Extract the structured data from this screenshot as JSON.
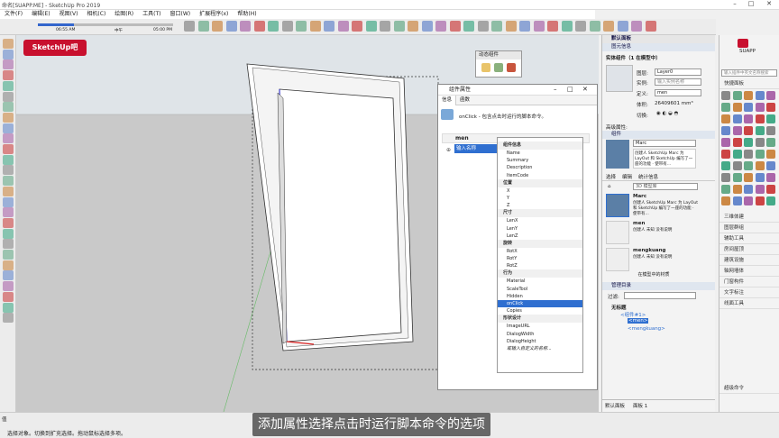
{
  "window": {
    "title": "命名[SUAPP.ME] - SketchUp Pro 2019"
  },
  "menus": [
    "文件(F)",
    "编辑(E)",
    "视图(V)",
    "相机(C)",
    "绘图(R)",
    "工具(T)",
    "窗口(W)",
    "扩展程序(x)",
    "帮助(H)"
  ],
  "shadow": {
    "time1": "06:55 AM",
    "time2": "中午",
    "time3": "05:00 PM"
  },
  "logo": {
    "text": "SketchUp吧"
  },
  "dynamic": {
    "title": "动态组件"
  },
  "attributes": {
    "title": "组件属性",
    "tab_info": "信息",
    "tab_functions": "函数",
    "onclick_desc": "onClick - 包含点击时运行的脚本命令。",
    "component_name": "men",
    "input_placeholder": "输入名称"
  },
  "dropdown": {
    "groups": [
      {
        "header": "组件信息",
        "items": [
          "Name",
          "Summary",
          "Description",
          "ItemCode"
        ]
      },
      {
        "header": "位置",
        "items": [
          "X",
          "Y",
          "Z"
        ]
      },
      {
        "header": "尺寸",
        "items": [
          "LenX",
          "LenY",
          "LenZ"
        ]
      },
      {
        "header": "旋转",
        "items": [
          "RotX",
          "RotY",
          "RotZ"
        ]
      },
      {
        "header": "行为",
        "items": [
          "Material",
          "ScaleTool",
          "Hidden",
          "onClick",
          "Copies"
        ]
      },
      {
        "header": "形状设计",
        "items": [
          "ImageURL",
          "DialogWidth",
          "DialogHeight"
        ]
      }
    ],
    "selected": "onClick",
    "footer": "或输入自定义的名称..."
  },
  "tray": {
    "title": "默认面板",
    "entity_header": "图元信息",
    "entity_title": "实体组件（1 在模型中）",
    "layer_label": "图层:",
    "layer_value": "Layer0",
    "instance_label": "实例:",
    "instance_placeholder": "输入实例名称",
    "definition_label": "定义:",
    "definition_value": "men",
    "volume_label": "体积:",
    "volume_value": "26409601 mm³",
    "toggle_label": "切换:",
    "advanced_label": "高级属性:",
    "components_header": "组件",
    "tab_select": "选择",
    "tab_edit": "编辑",
    "tab_stats": "统计信息",
    "model_label": "3D 模型库",
    "library": [
      {
        "name": "Marc",
        "desc": "创建人 SketchUp Marc 为 LayOut 和 SketchUp 编写了一座的功能 · 使带有..."
      },
      {
        "name": "men",
        "desc": "创建人 未知 没有说明"
      },
      {
        "name": "mengkuang",
        "desc": "创建人 未知 没有说明"
      }
    ],
    "model_footer": "在模型中的材质",
    "outliner_header": "管理目录",
    "filter_label": "过滤:",
    "outliner_root": "无标题",
    "outliner_items": [
      "<组件#1>",
      "<men>",
      "<mengkuang>"
    ],
    "bottom_tab1": "默认面板",
    "bottom_tab2": "面板 1"
  },
  "farright": {
    "title": "SUAPP",
    "search_placeholder": "输入插件中英文名称搜索",
    "quick": "快捷面板",
    "sections": [
      "三维体建",
      "图层群组",
      "辅助工具",
      "房间屋顶",
      "建筑设施",
      "轴网墙体",
      "门窗构件",
      "文字标注",
      "线面工具"
    ],
    "bottom": "超级命令"
  },
  "status": {
    "left": "选择对象。切换到扩充选择。拖动鼠标选择多项。",
    "measure": "值"
  },
  "subtitle": "添加属性选择点击时运行脚本命令的选项",
  "colors": {
    "selection": "#2f6fd0",
    "brand": "#c8102e"
  }
}
